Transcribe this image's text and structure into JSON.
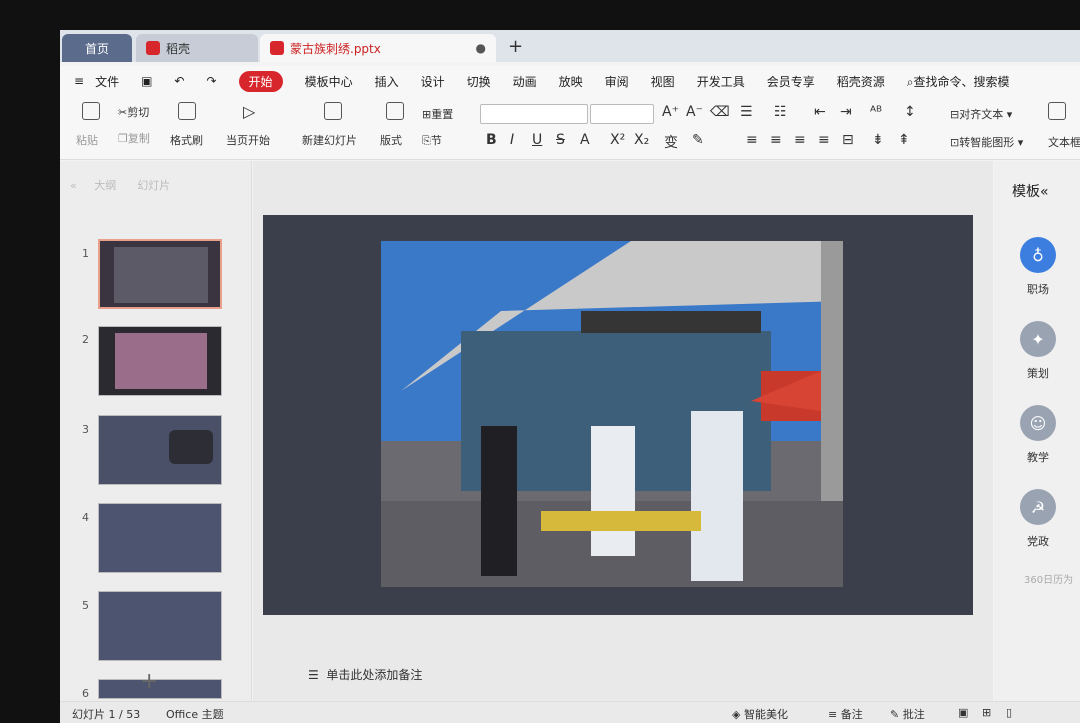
{
  "tabs": {
    "home": "首页",
    "wps": "稻壳",
    "doc": "蒙古族刺绣.pptx"
  },
  "menu": [
    "文件",
    "开始",
    "模板中心",
    "插入",
    "设计",
    "切换",
    "动画",
    "放映",
    "审阅",
    "视图",
    "开发工具",
    "会员专享",
    "稻壳资源"
  ],
  "search_placeholder": "查找命令、搜索模",
  "ribbon": {
    "paste": "粘贴",
    "cut": "剪切",
    "copy": "复制",
    "format_painter": "格式刷",
    "play_current": "当页开始",
    "new_slide": "新建幻灯片",
    "layout": "版式",
    "section": "节",
    "reset": "重置",
    "align_text": "对齐文本",
    "smartart": "转智能图形",
    "textbox": "文本框"
  },
  "left_panel": {
    "tabs": [
      "大纲",
      "幻灯片"
    ],
    "slide_numbers": [
      "1",
      "2",
      "3",
      "4",
      "5",
      "6"
    ]
  },
  "notes_placeholder": "单击此处添加备注",
  "right_panel": {
    "title": "模板",
    "items": [
      {
        "label": "职场",
        "icon": "tie-icon"
      },
      {
        "label": "策划",
        "icon": "bulb-icon"
      },
      {
        "label": "教学",
        "icon": "teacher-icon"
      },
      {
        "label": "党政",
        "icon": "party-icon"
      }
    ],
    "footer": "360日历为"
  },
  "status": {
    "slide_info": "幻灯片 1 / 53",
    "theme": "Office 主题",
    "smart_beautify": "智能美化",
    "notes": "备注",
    "comments": "批注"
  },
  "colors": {
    "accent": "#d8262d",
    "slide_bg": "#3b3f4c",
    "selected_icon": "#3b7ee0"
  }
}
